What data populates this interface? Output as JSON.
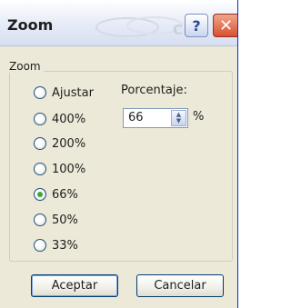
{
  "window": {
    "title": "Zoom",
    "watermark": "Clic",
    "help_label": "?",
    "close_label": "✕"
  },
  "zoom_group": {
    "label": "Zoom",
    "options": [
      {
        "label": "Ajustar",
        "checked": false
      },
      {
        "label": "400%",
        "checked": false
      },
      {
        "label": "200%",
        "checked": false
      },
      {
        "label": "100%",
        "checked": false
      },
      {
        "label": "66%",
        "checked": true
      },
      {
        "label": "50%",
        "checked": false
      },
      {
        "label": "33%",
        "checked": false
      }
    ]
  },
  "percentage": {
    "label": "Porcentaje:",
    "value": "66",
    "unit": "%"
  },
  "buttons": {
    "ok": "Aceptar",
    "cancel": "Cancelar"
  },
  "colors": {
    "dialog_bg": "#ece9d8",
    "radio_checked": "#3ea53e",
    "close_button": "#d9502f"
  },
  "icons": [
    "help-icon",
    "close-icon",
    "spinner-up-icon",
    "spinner-down-icon"
  ]
}
